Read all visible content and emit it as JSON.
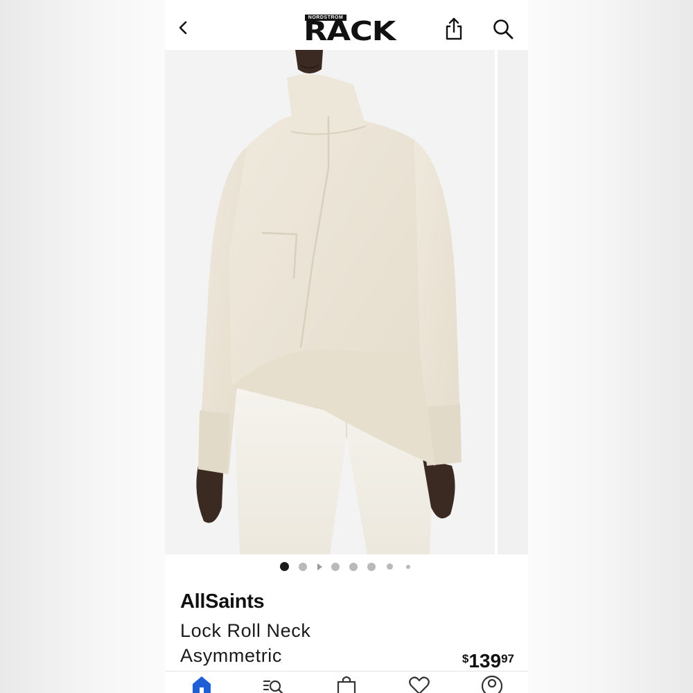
{
  "header": {
    "logo_small": "NORDSTROM",
    "logo_big": "RACK"
  },
  "gallery": {
    "image_count": 8,
    "active_index": 0,
    "image_description": "model wearing cream asymmetric roll neck sweater and white trousers"
  },
  "product": {
    "brand": "AllSaints",
    "title_line1": "Lock Roll Neck",
    "title_line2": "Asymmetric",
    "price_currency": "$",
    "price_dollars": "139",
    "price_cents": "97"
  },
  "tabs": [
    {
      "icon": "home-icon",
      "active": true
    },
    {
      "icon": "browse-search-icon",
      "active": false
    },
    {
      "icon": "bag-icon",
      "active": false
    },
    {
      "icon": "heart-icon",
      "active": false
    },
    {
      "icon": "account-icon",
      "active": false
    }
  ],
  "colors": {
    "accent": "#1f5fd6",
    "text": "#111111",
    "sweater": "#ebe4d6",
    "trousers": "#f3f1ea"
  }
}
